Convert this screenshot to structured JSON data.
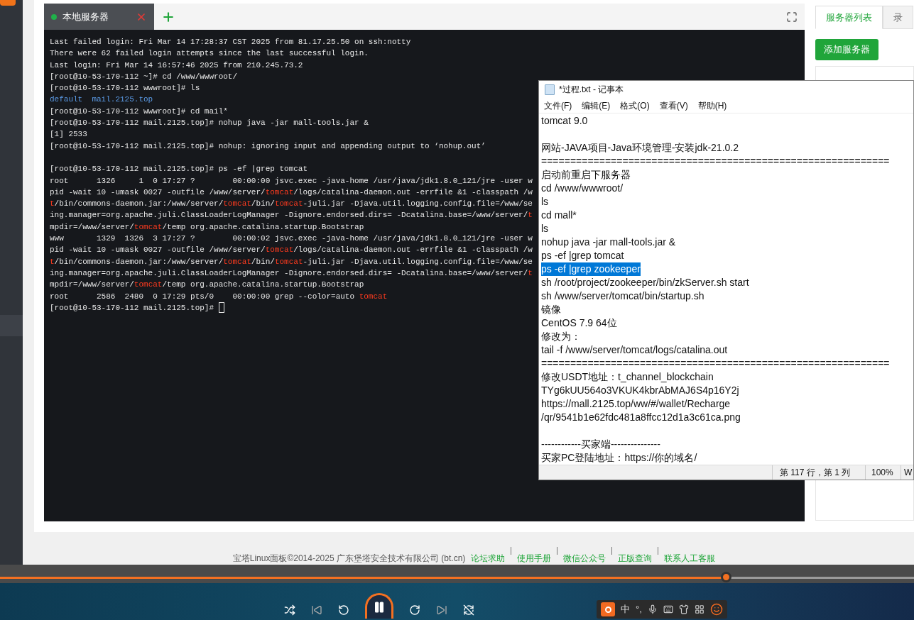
{
  "terminal_tabs": [
    {
      "label": "本地服务器",
      "selected": true,
      "connected": true
    }
  ],
  "terminal": {
    "lines": [
      {
        "segments": [
          {
            "text": "Last failed login: Fri Mar 14 17:28:37 CST 2025 from 81.17.25.50 on ssh:notty",
            "kind": "plain"
          }
        ]
      },
      {
        "segments": [
          {
            "text": "There were 62 failed login attempts since the last successful login.",
            "kind": "plain"
          }
        ]
      },
      {
        "segments": [
          {
            "text": "Last login: Fri Mar 14 16:57:46 2025 from 210.245.73.2",
            "kind": "plain"
          }
        ]
      },
      {
        "segments": [
          {
            "text": "[root@10-53-170-112 ~]# cd /www/wwwroot/",
            "kind": "plain"
          }
        ]
      },
      {
        "segments": [
          {
            "text": "[root@10-53-170-112 wwwroot]# ls",
            "kind": "plain"
          }
        ]
      },
      {
        "segments": [
          {
            "text": "default  mail.2125.top",
            "kind": "dir"
          }
        ]
      },
      {
        "segments": [
          {
            "text": "[root@10-53-170-112 wwwroot]# cd mail*",
            "kind": "plain"
          }
        ]
      },
      {
        "segments": [
          {
            "text": "[root@10-53-170-112 mail.2125.top]# nohup java -jar mall-tools.jar &",
            "kind": "plain"
          }
        ]
      },
      {
        "segments": [
          {
            "text": "[1] 2533",
            "kind": "plain"
          }
        ]
      },
      {
        "segments": [
          {
            "text": "[root@10-53-170-112 mail.2125.top]# nohup: ignoring input and appending output to ‘nohup.out’",
            "kind": "plain"
          }
        ]
      },
      {
        "gap_before": true,
        "segments": [
          {
            "text": "[root@10-53-170-112 mail.2125.top]# ps -ef |grep tomcat",
            "kind": "plain"
          }
        ]
      },
      {
        "segments": [
          {
            "text": "root      1326     1  0 17:27 ?        00:00:00 jsvc.exec -java-home /usr/java/jdk1.8.0_121/jre -user w",
            "kind": "plain"
          }
        ]
      },
      {
        "segments": [
          {
            "text": "pid -wait 10 -umask 0027 -outfile /www/server/",
            "kind": "plain"
          },
          {
            "text": "tomcat",
            "kind": "match"
          },
          {
            "text": "/logs/catalina-daemon.out -errfile &1 -classpath /w",
            "kind": "plain"
          }
        ]
      },
      {
        "segments": [
          {
            "text": "t",
            "kind": "match"
          },
          {
            "text": "/bin/commons-daemon.jar:/www/server/",
            "kind": "plain"
          },
          {
            "text": "tomcat",
            "kind": "match"
          },
          {
            "text": "/bin/",
            "kind": "plain"
          },
          {
            "text": "tomcat",
            "kind": "match"
          },
          {
            "text": "-juli.jar -Djava.util.logging.config.file=/www/se",
            "kind": "plain"
          }
        ]
      },
      {
        "segments": [
          {
            "text": "ing.manager=org.apache.juli.ClassLoaderLogManager -Dignore.endorsed.dirs= -Dcatalina.base=/www/server/",
            "kind": "plain"
          },
          {
            "text": "t",
            "kind": "match"
          }
        ]
      },
      {
        "segments": [
          {
            "text": "mpdir=/www/server/",
            "kind": "plain"
          },
          {
            "text": "tomcat",
            "kind": "match"
          },
          {
            "text": "/temp org.apache.catalina.startup.Bootstrap",
            "kind": "plain"
          }
        ]
      },
      {
        "segments": [
          {
            "text": "www       1329  1326  3 17:27 ?        00:00:02 jsvc.exec -java-home /usr/java/jdk1.8.0_121/jre -user w",
            "kind": "plain"
          }
        ]
      },
      {
        "segments": [
          {
            "text": "pid -wait 10 -umask 0027 -outfile /www/server/",
            "kind": "plain"
          },
          {
            "text": "tomcat",
            "kind": "match"
          },
          {
            "text": "/logs/catalina-daemon.out -errfile &1 -classpath /w",
            "kind": "plain"
          }
        ]
      },
      {
        "segments": [
          {
            "text": "t",
            "kind": "match"
          },
          {
            "text": "/bin/commons-daemon.jar:/www/server/",
            "kind": "plain"
          },
          {
            "text": "tomcat",
            "kind": "match"
          },
          {
            "text": "/bin/",
            "kind": "plain"
          },
          {
            "text": "tomcat",
            "kind": "match"
          },
          {
            "text": "-juli.jar -Djava.util.logging.config.file=/www/se",
            "kind": "plain"
          }
        ]
      },
      {
        "segments": [
          {
            "text": "ing.manager=org.apache.juli.ClassLoaderLogManager -Dignore.endorsed.dirs= -Dcatalina.base=/www/server/",
            "kind": "plain"
          },
          {
            "text": "t",
            "kind": "match"
          }
        ]
      },
      {
        "segments": [
          {
            "text": "mpdir=/www/server/",
            "kind": "plain"
          },
          {
            "text": "tomcat",
            "kind": "match"
          },
          {
            "text": "/temp org.apache.catalina.startup.Bootstrap",
            "kind": "plain"
          }
        ]
      },
      {
        "segments": [
          {
            "text": "root      2586  2480  0 17:29 pts/0    00:00:00 grep --color=auto ",
            "kind": "plain"
          },
          {
            "text": "tomcat",
            "kind": "match"
          }
        ]
      },
      {
        "cursor": true,
        "segments": [
          {
            "text": "[root@10-53-170-112 mail.2125.top]# ",
            "kind": "plain"
          }
        ]
      }
    ]
  },
  "right_panel": {
    "tabs": [
      {
        "label": "服务器列表",
        "selected": true
      },
      {
        "label": "录",
        "selected": false
      }
    ],
    "add_button": "添加服务器"
  },
  "notepad": {
    "title": "*过程.txt - 记事本",
    "menu": [
      "文件(F)",
      "编辑(E)",
      "格式(O)",
      "查看(V)",
      "帮助(H)"
    ],
    "lines": [
      {
        "kind": "text",
        "text": "tomcat 9.0",
        "selected": false
      },
      {
        "kind": "blank"
      },
      {
        "kind": "text",
        "text": "网站-JAVA项目-Java环境管理-安装jdk-21.0.2",
        "selected": false
      },
      {
        "kind": "text",
        "text": "============================================================",
        "selected": false
      },
      {
        "kind": "text",
        "text": "启动前重启下服务器",
        "selected": false
      },
      {
        "kind": "text",
        "text": "cd /www/wwwroot/",
        "selected": false
      },
      {
        "kind": "text",
        "text": "ls",
        "selected": false
      },
      {
        "kind": "text",
        "text": "cd mall*",
        "selected": false
      },
      {
        "kind": "text",
        "text": "ls",
        "selected": false
      },
      {
        "kind": "text",
        "text": "nohup java -jar mall-tools.jar &",
        "selected": false
      },
      {
        "kind": "text",
        "text": "ps -ef |grep tomcat",
        "selected": false
      },
      {
        "kind": "text",
        "text": "ps -ef |grep zookeeper",
        "selected": true
      },
      {
        "kind": "text",
        "text": "sh /root/project/zookeeper/bin/zkServer.sh start",
        "selected": false
      },
      {
        "kind": "text",
        "text": "sh /www/server/tomcat/bin/startup.sh",
        "selected": false
      },
      {
        "kind": "text",
        "text": "镜像",
        "selected": false
      },
      {
        "kind": "text",
        "text": "CentOS 7.9 64位",
        "selected": false
      },
      {
        "kind": "text",
        "text": "修改为：",
        "selected": false
      },
      {
        "kind": "text",
        "text": "tail -f /www/server/tomcat/logs/catalina.out",
        "selected": false
      },
      {
        "kind": "text",
        "text": "============================================================",
        "selected": false
      },
      {
        "kind": "text",
        "text": "修改USDT地址：t_channel_blockchain",
        "selected": false
      },
      {
        "kind": "text",
        "text": "TYg6kUU564o3VKUK4kbrAbMAJ6S4p16Y2j",
        "selected": false
      },
      {
        "kind": "text",
        "text": "https://mall.2125.top/ww/#/wallet/Recharge",
        "selected": false
      },
      {
        "kind": "text",
        "text": "/qr/9541b1e62fdc481a8ffcc12d1a3c61ca.png",
        "selected": false
      },
      {
        "kind": "blank"
      },
      {
        "kind": "text",
        "text": "------------买家端---------------",
        "selected": false
      },
      {
        "kind": "text",
        "text": "买家PC登陆地址：https://你的域名/",
        "selected": false
      }
    ],
    "status": {
      "position": "第 117 行，第 1 列",
      "zoom": "100%",
      "encoding": "W"
    }
  },
  "footer": {
    "copyright": "宝塔Linux面板©2014-2025 广东堡塔安全技术有限公司 (bt.cn)",
    "links": [
      "论坛求助",
      "使用手册",
      "微信公众号",
      "正版查询",
      "联系人工客服"
    ]
  },
  "player": {
    "progress": {
      "level": 0.794
    },
    "playing": true
  },
  "ime": {
    "mode": "中",
    "punctuation": "°,"
  }
}
